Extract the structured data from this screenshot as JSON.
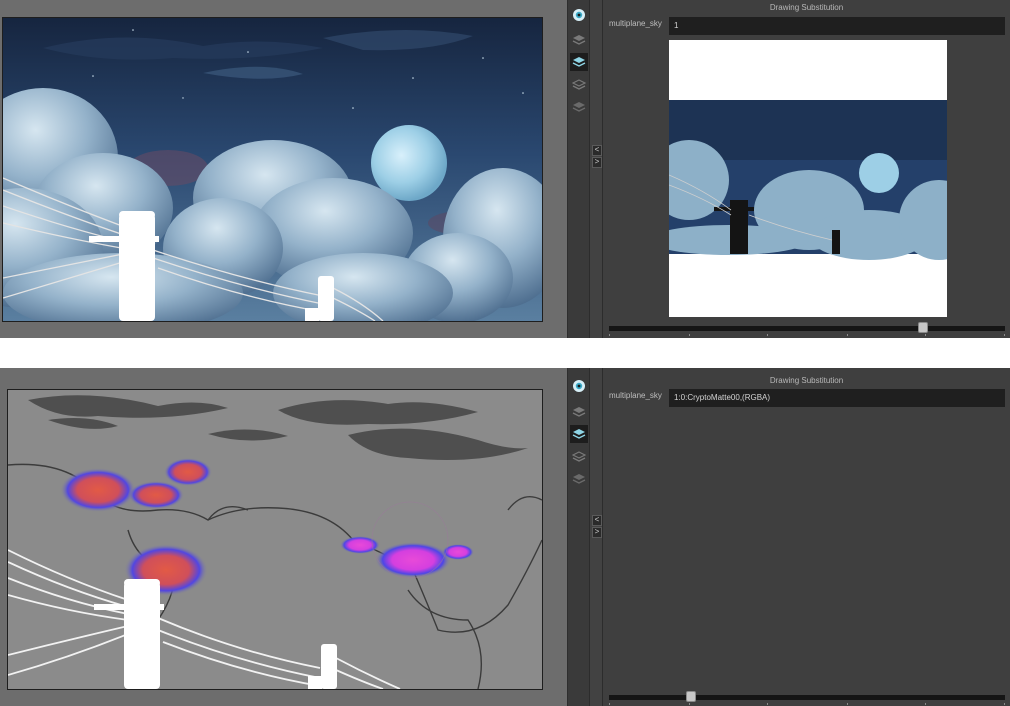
{
  "panels": [
    {
      "id": "top",
      "panel_title": "Drawing Substitution",
      "field_label": "multiplane_sky",
      "field_value": "1",
      "view": "color",
      "slider": {
        "position_fraction": 0.8
      }
    },
    {
      "id": "bottom",
      "panel_title": "Drawing Substitution",
      "field_label": "multiplane_sky",
      "field_value": "1:0:CryptoMatte00,(RGBA)",
      "view": "cryptomatte",
      "slider": {
        "position_fraction": 0.2
      }
    }
  ],
  "toolbar": {
    "buttons": [
      "eye-icon",
      "layer-stack-icon",
      "layer-stack-active-icon",
      "layer-stack-icon",
      "layer-stack-icon"
    ],
    "collapse_buttons": [
      "<",
      ">"
    ]
  },
  "colors": {
    "sky_dark": "#1d3151",
    "sky_mid": "#2d4c74",
    "cloud_light": "#a8c4d8",
    "moon": "#9dd0e8",
    "matte_gray": "#8b8b8b",
    "matte_red": "#e0564a",
    "matte_blue": "#4a46e6",
    "matte_magenta": "#e03ae0"
  }
}
